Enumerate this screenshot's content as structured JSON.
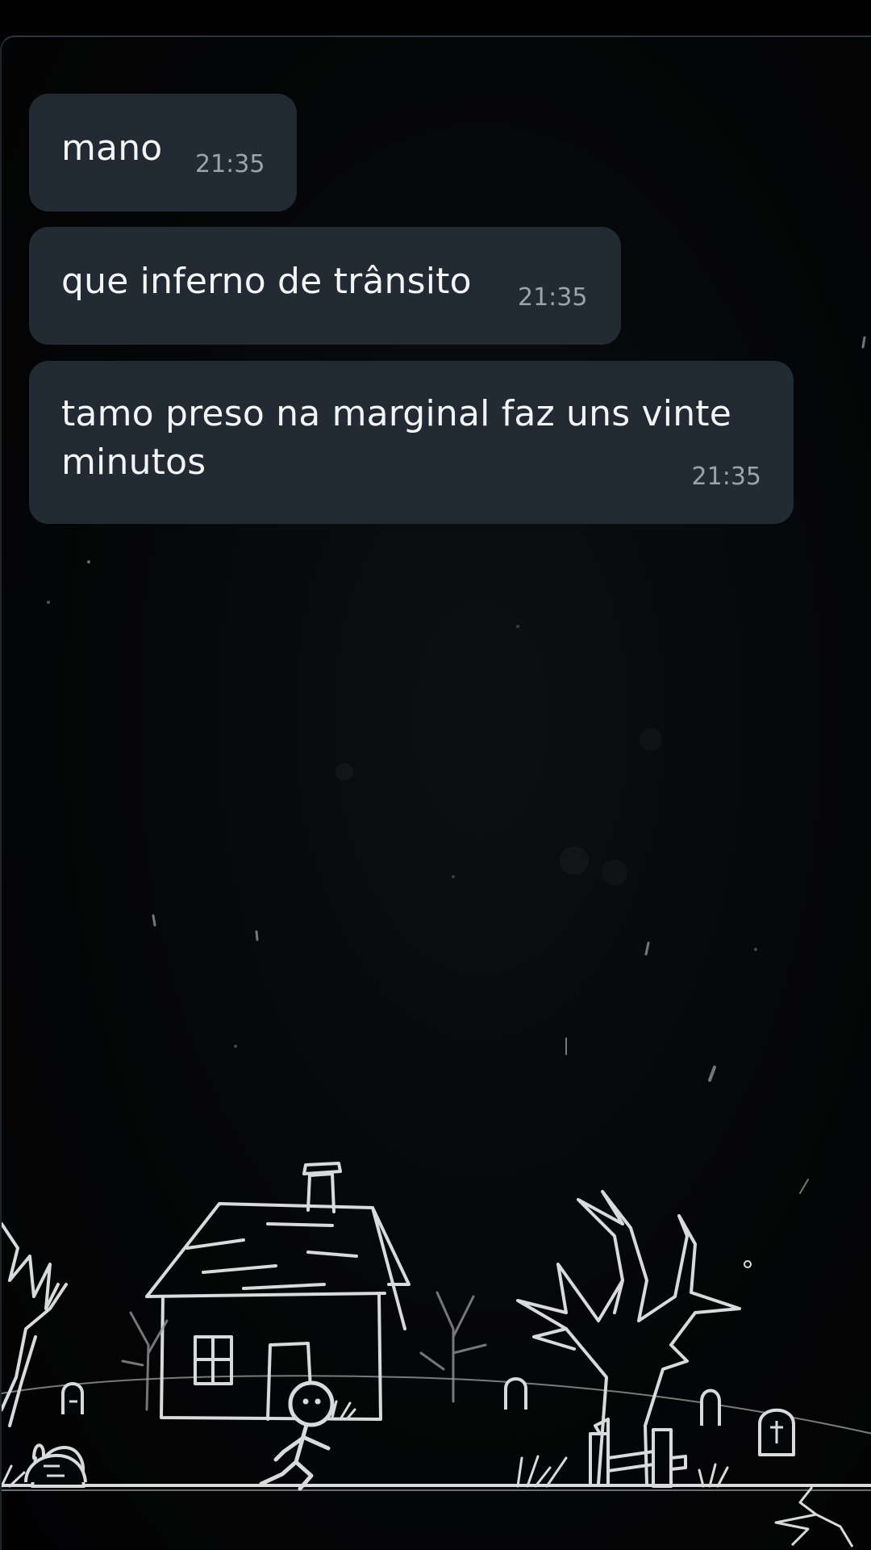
{
  "messages": [
    {
      "text": "mano",
      "time": "21:35"
    },
    {
      "text": "que inferno de trânsito",
      "time": "21:35"
    },
    {
      "text": "tamo preso na marginal faz uns vinte minutos",
      "time": "21:35"
    }
  ],
  "theme": {
    "background": "#020203",
    "bubble": "#222b33",
    "text": "#f2f4f5",
    "time": "#9aa4ab",
    "drawing": "#d8dadb"
  },
  "wallpaper": {
    "style": "line drawing of a haunted house, dead trees, tombstones and a running stick figure under falling rain"
  }
}
